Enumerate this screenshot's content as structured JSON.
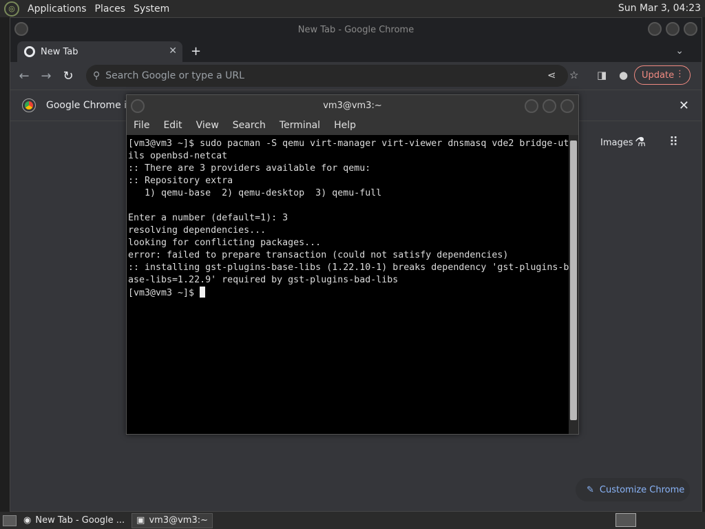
{
  "top_panel": {
    "menus": [
      "Applications",
      "Places",
      "System"
    ],
    "clock": "Sun Mar  3, 04:23"
  },
  "chrome": {
    "window_title": "New Tab - Google Chrome",
    "tab_title": "New Tab",
    "omnibox_placeholder": "Search Google or type a URL",
    "update_label": "Update",
    "infobar_text": "Google Chrome isn",
    "ntp_images_label": "Images",
    "customize_label": "Customize Chrome"
  },
  "terminal": {
    "title": "vm3@vm3:~",
    "menu": [
      "File",
      "Edit",
      "View",
      "Search",
      "Terminal",
      "Help"
    ],
    "lines": [
      "[vm3@vm3 ~]$ sudo pacman -S qemu virt-manager virt-viewer dnsmasq vde2 bridge-ut",
      "ils openbsd-netcat",
      ":: There are 3 providers available for qemu:",
      ":: Repository extra",
      "   1) qemu-base  2) qemu-desktop  3) qemu-full",
      "",
      "Enter a number (default=1): 3",
      "resolving dependencies...",
      "looking for conflicting packages...",
      "error: failed to prepare transaction (could not satisfy dependencies)",
      ":: installing gst-plugins-base-libs (1.22.10-1) breaks dependency 'gst-plugins-b",
      "ase-libs=1.22.9' required by gst-plugins-bad-libs"
    ],
    "prompt": "[vm3@vm3 ~]$ "
  },
  "taskbar": {
    "tasks": [
      "New Tab - Google ...",
      "vm3@vm3:~"
    ]
  }
}
